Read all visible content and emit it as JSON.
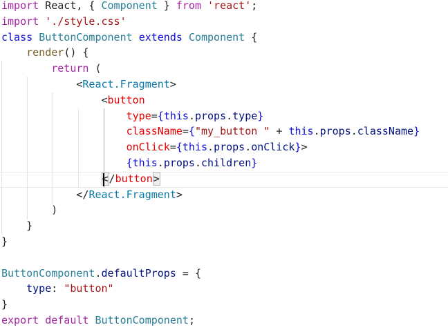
{
  "colors": {
    "keyword": "#a626a4",
    "declaration": "#0d0dd6",
    "class_name": "#267f99",
    "tag": "#0a7aa8",
    "attribute": "#e50000",
    "string": "#a31515",
    "property": "#001080",
    "method": "#795e26",
    "plain": "#1e1e1e"
  },
  "code": {
    "lines": [
      {
        "tokens": [
          {
            "t": "import",
            "c": "keyword"
          },
          {
            "t": " React, { ",
            "c": "plain"
          },
          {
            "t": "Component",
            "c": "class_name"
          },
          {
            "t": " } ",
            "c": "plain"
          },
          {
            "t": "from",
            "c": "keyword"
          },
          {
            "t": " ",
            "c": "plain"
          },
          {
            "t": "'react'",
            "c": "string"
          },
          {
            "t": ";",
            "c": "plain"
          }
        ]
      },
      {
        "tokens": [
          {
            "t": "import",
            "c": "keyword"
          },
          {
            "t": " ",
            "c": "plain"
          },
          {
            "t": "'./style.css'",
            "c": "string"
          }
        ]
      },
      {
        "tokens": [
          {
            "t": "class",
            "c": "declaration"
          },
          {
            "t": " ",
            "c": "plain"
          },
          {
            "t": "ButtonComponent",
            "c": "class_name"
          },
          {
            "t": " ",
            "c": "plain"
          },
          {
            "t": "extends",
            "c": "declaration"
          },
          {
            "t": " ",
            "c": "plain"
          },
          {
            "t": "Component",
            "c": "class_name"
          },
          {
            "t": " {",
            "c": "plain"
          }
        ]
      },
      {
        "tokens": [
          {
            "t": "    ",
            "c": "plain"
          },
          {
            "t": "render",
            "c": "method"
          },
          {
            "t": "() {",
            "c": "plain"
          }
        ]
      },
      {
        "tokens": [
          {
            "t": "        ",
            "c": "plain"
          },
          {
            "t": "return",
            "c": "keyword"
          },
          {
            "t": " (",
            "c": "plain"
          }
        ]
      },
      {
        "tokens": [
          {
            "t": "            ",
            "c": "plain"
          },
          {
            "t": "<",
            "c": "plain"
          },
          {
            "t": "React.Fragment",
            "c": "tag"
          },
          {
            "t": ">",
            "c": "plain"
          }
        ]
      },
      {
        "tokens": [
          {
            "t": "                ",
            "c": "plain"
          },
          {
            "t": "<",
            "c": "plain"
          },
          {
            "t": "button",
            "c": "attribute"
          }
        ]
      },
      {
        "tokens": [
          {
            "t": "                    ",
            "c": "plain"
          },
          {
            "t": "type",
            "c": "attribute"
          },
          {
            "t": "=",
            "c": "plain"
          },
          {
            "t": "{",
            "c": "declaration"
          },
          {
            "t": "this",
            "c": "declaration"
          },
          {
            "t": ".",
            "c": "plain"
          },
          {
            "t": "props",
            "c": "property"
          },
          {
            "t": ".",
            "c": "plain"
          },
          {
            "t": "type",
            "c": "property"
          },
          {
            "t": "}",
            "c": "declaration"
          }
        ]
      },
      {
        "tokens": [
          {
            "t": "                    ",
            "c": "plain"
          },
          {
            "t": "className",
            "c": "attribute"
          },
          {
            "t": "=",
            "c": "plain"
          },
          {
            "t": "{",
            "c": "declaration"
          },
          {
            "t": "\"my_button \"",
            "c": "string"
          },
          {
            "t": " + ",
            "c": "plain"
          },
          {
            "t": "this",
            "c": "declaration"
          },
          {
            "t": ".",
            "c": "plain"
          },
          {
            "t": "props",
            "c": "property"
          },
          {
            "t": ".",
            "c": "plain"
          },
          {
            "t": "className",
            "c": "property"
          },
          {
            "t": "}",
            "c": "declaration"
          }
        ]
      },
      {
        "tokens": [
          {
            "t": "                    ",
            "c": "plain"
          },
          {
            "t": "onClick",
            "c": "attribute"
          },
          {
            "t": "=",
            "c": "plain"
          },
          {
            "t": "{",
            "c": "declaration"
          },
          {
            "t": "this",
            "c": "declaration"
          },
          {
            "t": ".",
            "c": "plain"
          },
          {
            "t": "props",
            "c": "property"
          },
          {
            "t": ".",
            "c": "plain"
          },
          {
            "t": "onClick",
            "c": "property"
          },
          {
            "t": "}",
            "c": "declaration"
          },
          {
            "t": ">",
            "c": "plain"
          }
        ]
      },
      {
        "tokens": [
          {
            "t": "                    ",
            "c": "plain"
          },
          {
            "t": "{",
            "c": "declaration"
          },
          {
            "t": "this",
            "c": "declaration"
          },
          {
            "t": ".",
            "c": "plain"
          },
          {
            "t": "props",
            "c": "property"
          },
          {
            "t": ".",
            "c": "plain"
          },
          {
            "t": "children",
            "c": "property"
          },
          {
            "t": "}",
            "c": "declaration"
          }
        ]
      },
      {
        "tokens": [
          {
            "t": "                ",
            "c": "plain"
          },
          {
            "t": "<",
            "c": "plain",
            "box": true
          },
          {
            "t": "/",
            "c": "plain"
          },
          {
            "t": "button",
            "c": "attribute"
          },
          {
            "t": ">",
            "c": "plain",
            "box": true
          }
        ]
      },
      {
        "tokens": [
          {
            "t": "            ",
            "c": "plain"
          },
          {
            "t": "</",
            "c": "plain"
          },
          {
            "t": "React.Fragment",
            "c": "tag"
          },
          {
            "t": ">",
            "c": "plain"
          }
        ]
      },
      {
        "tokens": [
          {
            "t": "        )",
            "c": "plain"
          }
        ]
      },
      {
        "tokens": [
          {
            "t": "    }",
            "c": "plain"
          }
        ]
      },
      {
        "tokens": [
          {
            "t": "}",
            "c": "plain"
          }
        ]
      },
      {
        "tokens": []
      },
      {
        "tokens": [
          {
            "t": "ButtonComponent",
            "c": "class_name"
          },
          {
            "t": ".",
            "c": "plain"
          },
          {
            "t": "defaultProps",
            "c": "property"
          },
          {
            "t": " = {",
            "c": "plain"
          }
        ]
      },
      {
        "tokens": [
          {
            "t": "    ",
            "c": "plain"
          },
          {
            "t": "type",
            "c": "property"
          },
          {
            "t": ": ",
            "c": "plain"
          },
          {
            "t": "\"button\"",
            "c": "string"
          }
        ]
      },
      {
        "tokens": [
          {
            "t": "}",
            "c": "plain"
          }
        ]
      },
      {
        "tokens": [
          {
            "t": "export",
            "c": "keyword"
          },
          {
            "t": " ",
            "c": "plain"
          },
          {
            "t": "default",
            "c": "keyword"
          },
          {
            "t": " ",
            "c": "plain"
          },
          {
            "t": "ButtonComponent",
            "c": "class_name"
          },
          {
            "t": ";",
            "c": "plain"
          }
        ]
      }
    ]
  }
}
